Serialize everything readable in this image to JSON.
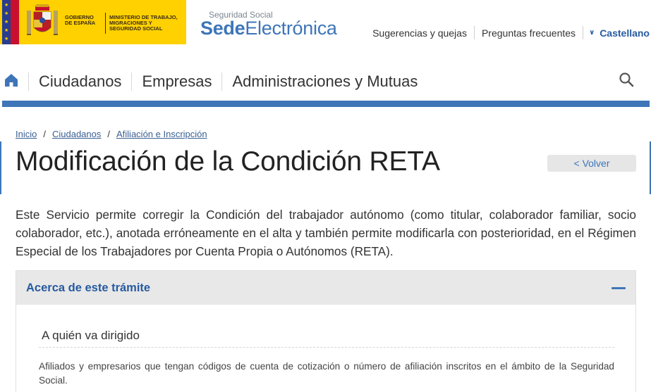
{
  "header": {
    "gov_left": "Gobierno de España",
    "gov_right": "Ministerio de Trabajo, Migraciones y Seguridad Social",
    "brand_small": "Seguridad Social",
    "brand_bold": "Sede",
    "brand_light": "Electrónica",
    "links": {
      "suggestions": "Sugerencias y quejas",
      "faq": "Preguntas frecuentes",
      "language": "Castellano"
    }
  },
  "nav": {
    "items": [
      "Ciudadanos",
      "Empresas",
      "Administraciones y Mutuas"
    ]
  },
  "breadcrumb": [
    "Inicio",
    "Ciudadanos",
    "Afiliación e Inscripción"
  ],
  "page": {
    "title": "Modificación de la Condición RETA",
    "back_label": "< Volver",
    "intro": "Este Servicio permite corregir la Condición del trabajador autónomo (como titular, colaborador familiar, socio colaborador, etc.), anotada erróneamente en el alta y también permite modificarla con posterioridad, en el Régimen Especial de los Trabajadores por Cuenta Propia o Autónomos (RETA)."
  },
  "accordion": {
    "title": "Acerca de este trámite",
    "section_title": "A quién va dirigido",
    "section_text": "Afiliados y empresarios que tengan códigos de cuenta de cotización o número de afiliación inscritos en el ámbito de la Seguridad Social."
  },
  "colors": {
    "brand_blue": "#3e75b8",
    "gov_yellow": "#ffd100",
    "link_blue": "#275aa0"
  }
}
